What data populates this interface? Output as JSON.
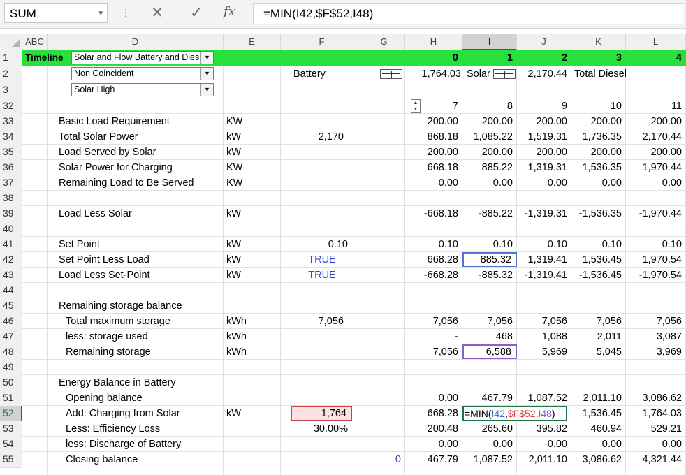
{
  "formula_bar": {
    "name_box": "SUM",
    "cancel_glyph": "✕",
    "enter_glyph": "✓",
    "fx_label": "fx",
    "formula": "=MIN(I42,$F$52,I48)"
  },
  "columns": [
    "ABC",
    "D",
    "E",
    "F",
    "G",
    "H",
    "I",
    "J",
    "K",
    "L"
  ],
  "timeline_row": {
    "label": "Timeline",
    "dropdown": "Solar and Flow Battery and Dies",
    "H": "0",
    "I": "1",
    "J": "2",
    "K": "3",
    "L": "4"
  },
  "row2": {
    "dropdown": "Non Coincident",
    "battery_label": "Battery",
    "battery_value": "1,764.03",
    "solar_label": "Solar",
    "solar_value": "2,170.44",
    "total_label": "Total Diesel"
  },
  "row3": {
    "dropdown": "Solar High"
  },
  "rows": [
    {
      "n": "32",
      "label": "",
      "unit": "",
      "f": "",
      "g": "",
      "h": "7",
      "i": "8",
      "j": "9",
      "k": "10",
      "l": "11"
    },
    {
      "n": "33",
      "label": "Basic Load Requirement",
      "unit": "KW",
      "f": "",
      "g": "",
      "h": "200.00",
      "i": "200.00",
      "j": "200.00",
      "k": "200.00",
      "l": "200.00"
    },
    {
      "n": "34",
      "label": "Total Solar Power",
      "unit": "kW",
      "f": "2,170",
      "g": "",
      "h": "868.18",
      "i": "1,085.22",
      "j": "1,519.31",
      "k": "1,736.35",
      "l": "2,170.44"
    },
    {
      "n": "35",
      "label": "Load Served by Solar",
      "unit": "kW",
      "f": "",
      "g": "",
      "h": "200.00",
      "i": "200.00",
      "j": "200.00",
      "k": "200.00",
      "l": "200.00"
    },
    {
      "n": "36",
      "label": "Solar Power for Charging",
      "unit": "KW",
      "f": "",
      "g": "",
      "h": "668.18",
      "i": "885.22",
      "j": "1,319.31",
      "k": "1,536.35",
      "l": "1,970.44"
    },
    {
      "n": "37",
      "label": "Remaining Load to Be Served",
      "unit": "KW",
      "f": "",
      "g": "",
      "h": "0.00",
      "i": "0.00",
      "j": "0.00",
      "k": "0.00",
      "l": "0.00"
    },
    {
      "n": "38",
      "label": "",
      "unit": "",
      "f": "",
      "g": "",
      "h": "",
      "i": "",
      "j": "",
      "k": "",
      "l": ""
    },
    {
      "n": "39",
      "label": "Load Less Solar",
      "unit": "kW",
      "f": "",
      "g": "",
      "h": "-668.18",
      "i": "-885.22",
      "j": "-1,319.31",
      "k": "-1,536.35",
      "l": "-1,970.44"
    },
    {
      "n": "40",
      "label": "",
      "unit": "",
      "f": "",
      "g": "",
      "h": "",
      "i": "",
      "j": "",
      "k": "",
      "l": ""
    },
    {
      "n": "41",
      "label": "Set Point",
      "unit": "kW",
      "f": "0.10",
      "g": "",
      "h": "0.10",
      "i": "0.10",
      "j": "0.10",
      "k": "0.10",
      "l": "0.10"
    },
    {
      "n": "42",
      "label": "Set Point Less Load",
      "unit": "kW",
      "f": "TRUE",
      "g": "",
      "h": "668.28",
      "i": "885.32",
      "j": "1,319.41",
      "k": "1,536.45",
      "l": "1,970.54"
    },
    {
      "n": "43",
      "label": "Load Less Set-Point",
      "unit": "kW",
      "f": "TRUE",
      "g": "",
      "h": "-668.28",
      "i": "-885.32",
      "j": "-1,319.41",
      "k": "-1,536.45",
      "l": "-1,970.54"
    },
    {
      "n": "44",
      "label": "",
      "unit": "",
      "f": "",
      "g": "",
      "h": "",
      "i": "",
      "j": "",
      "k": "",
      "l": ""
    },
    {
      "n": "45",
      "label": "Remaining storage balance",
      "unit": "",
      "f": "",
      "g": "",
      "h": "",
      "i": "",
      "j": "",
      "k": "",
      "l": ""
    },
    {
      "n": "46",
      "label": "Total maximum storage",
      "unit": "kWh",
      "f": "7,056",
      "g": "",
      "h": "7,056",
      "i": "7,056",
      "j": "7,056",
      "k": "7,056",
      "l": "7,056"
    },
    {
      "n": "47",
      "label": "less: storage used",
      "unit": "kWh",
      "f": "",
      "g": "",
      "h": "-",
      "i": "468",
      "j": "1,088",
      "k": "2,011",
      "l": "3,087"
    },
    {
      "n": "48",
      "label": "Remaining storage",
      "unit": "kWh",
      "f": "",
      "g": "",
      "h": "7,056",
      "i": "6,588",
      "j": "5,969",
      "k": "5,045",
      "l": "3,969"
    },
    {
      "n": "49",
      "label": "",
      "unit": "",
      "f": "",
      "g": "",
      "h": "",
      "i": "",
      "j": "",
      "k": "",
      "l": ""
    },
    {
      "n": "50",
      "label": "Energy Balance in Battery",
      "unit": "",
      "f": "",
      "g": "",
      "h": "",
      "i": "",
      "j": "",
      "k": "",
      "l": ""
    },
    {
      "n": "51",
      "label": "Opening balance",
      "unit": "",
      "f": "",
      "g": "",
      "h": "0.00",
      "i": "467.79",
      "j": "1,087.52",
      "k": "2,011.10",
      "l": "3,086.62"
    },
    {
      "n": "52",
      "label": "Add: Charging from Solar",
      "unit": "kW",
      "f": "1,764",
      "g": "",
      "h": "668.28",
      "i": "",
      "j": "",
      "k": "1,536.45",
      "l": "1,764.03"
    },
    {
      "n": "53",
      "label": "Less: Efficiency Loss",
      "unit": "",
      "f": "30.00%",
      "g": "",
      "h": "200.48",
      "i": "265.60",
      "j": "395.82",
      "k": "460.94",
      "l": "529.21"
    },
    {
      "n": "54",
      "label": "less: Discharge of Battery",
      "unit": "",
      "f": "",
      "g": "",
      "h": "0.00",
      "i": "0.00",
      "j": "0.00",
      "k": "0.00",
      "l": "0.00"
    },
    {
      "n": "55",
      "label": "Closing balance",
      "unit": "",
      "f": "",
      "g": "0",
      "h": "467.79",
      "i": "1,087.52",
      "j": "2,011.10",
      "k": "3,086.62",
      "l": "4,321.44"
    }
  ],
  "editing_cell": {
    "prefix": "=MIN(",
    "ref1": "I42",
    "sep1": ",",
    "ref2": "$F$52",
    "sep2": ",",
    "ref3": "I48",
    "suffix": ")"
  },
  "colors": {
    "timeline_green": "#27e03c",
    "selection_green": "#217346",
    "ref_blue": "#4f77d2",
    "ref_red": "#c44444",
    "ref_purple": "#8a5fc6"
  }
}
